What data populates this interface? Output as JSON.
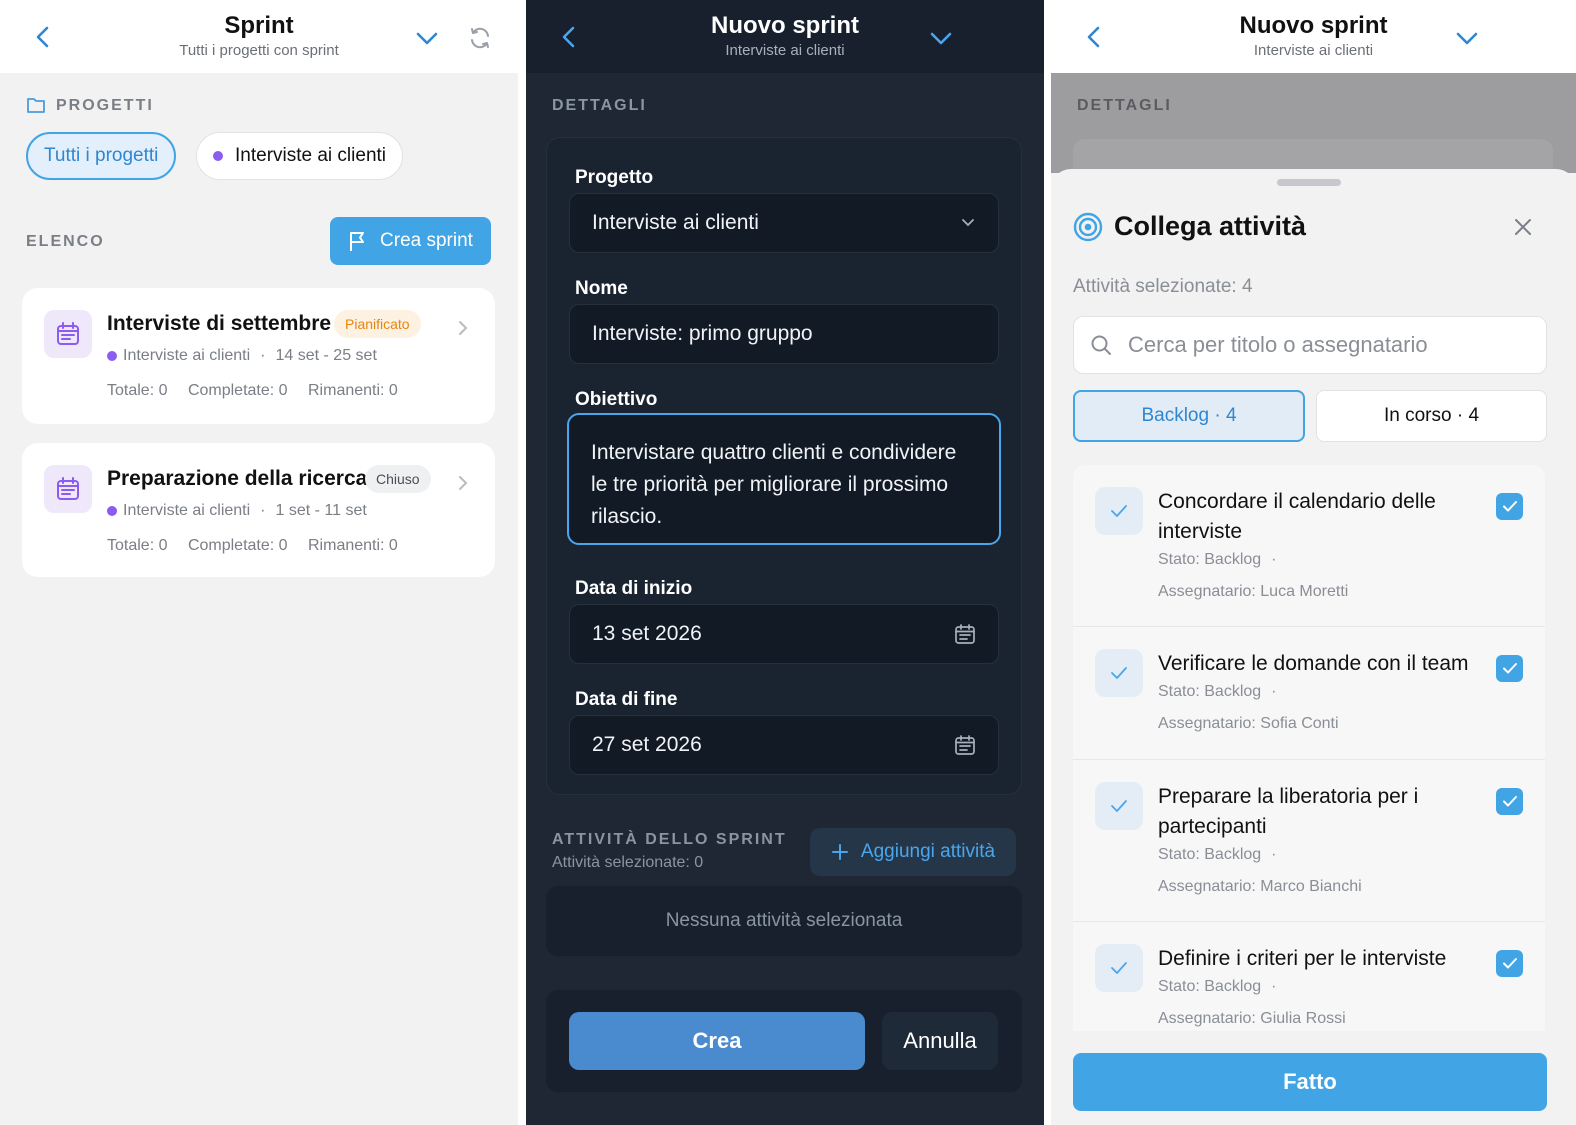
{
  "panel1": {
    "header": {
      "title": "Sprint",
      "subtitle": "Tutti i progetti con sprint"
    },
    "projects_label": "PROGETTI",
    "chips": {
      "all": "Tutti i progetti",
      "project": "Interviste ai clienti"
    },
    "list_label": "ELENCO",
    "create_button": "Crea sprint",
    "sprints": [
      {
        "title": "Interviste di settembre",
        "badge": "Pianificato",
        "project": "Interviste ai clienti",
        "dates": "14 set - 25 set",
        "total": "Totale: 0",
        "completed": "Completate: 0",
        "remaining": "Rimanenti: 0"
      },
      {
        "title": "Preparazione della ricerca",
        "badge": "Chiuso",
        "project": "Interviste ai clienti",
        "dates": "1 set - 11 set",
        "total": "Totale: 0",
        "completed": "Completate: 0",
        "remaining": "Rimanenti: 0"
      }
    ],
    "meta_separator": "·"
  },
  "panel2": {
    "header": {
      "title": "Nuovo sprint",
      "subtitle": "Interviste ai clienti"
    },
    "details_label": "DETTAGLI",
    "form": {
      "project_label": "Progetto",
      "project_value": "Interviste ai clienti",
      "name_label": "Nome",
      "name_value": "Interviste: primo gruppo",
      "goal_label": "Obiettivo",
      "goal_value": "Intervistare quattro clienti e condividere le tre priorità per migliorare il prossimo rilascio.",
      "start_label": "Data di inizio",
      "start_value": "13 set 2026",
      "end_label": "Data di fine",
      "end_value": "27 set 2026"
    },
    "activities": {
      "label": "ATTIVITÀ DELLO SPRINT",
      "count": "Attività selezionate: 0",
      "add_button": "Aggiungi attività",
      "empty": "Nessuna attività selezionata"
    },
    "create_button": "Crea",
    "cancel_button": "Annulla"
  },
  "panel3": {
    "header": {
      "title": "Nuovo sprint",
      "subtitle": "Interviste ai clienti"
    },
    "details_label": "DETTAGLI",
    "sheet": {
      "title": "Collega attività",
      "count": "Attività selezionate: 4",
      "search_placeholder": "Cerca per titolo o assegnatario",
      "tabs": {
        "backlog": "Backlog · 4",
        "in_progress": "In corso · 4"
      },
      "tasks": [
        {
          "title": "Concordare il calendario delle interviste",
          "state": "Stato: Backlog",
          "assignee": "Assegnatario: Luca Moretti"
        },
        {
          "title": "Verificare le domande con il team",
          "state": "Stato: Backlog",
          "assignee": "Assegnatario: Sofia Conti"
        },
        {
          "title": "Preparare la liberatoria per i partecipanti",
          "state": "Stato: Backlog",
          "assignee": "Assegnatario: Marco Bianchi"
        },
        {
          "title": "Definire i criteri per le interviste",
          "state": "Stato: Backlog",
          "assignee": "Assegnatario: Giulia Rossi"
        }
      ],
      "done_button": "Fatto"
    }
  },
  "colors": {
    "accent": "#41a4e5",
    "dark_bg": "#1e2733",
    "badge_planned": "#e8860f",
    "purple_dot": "#8a5cf0"
  }
}
